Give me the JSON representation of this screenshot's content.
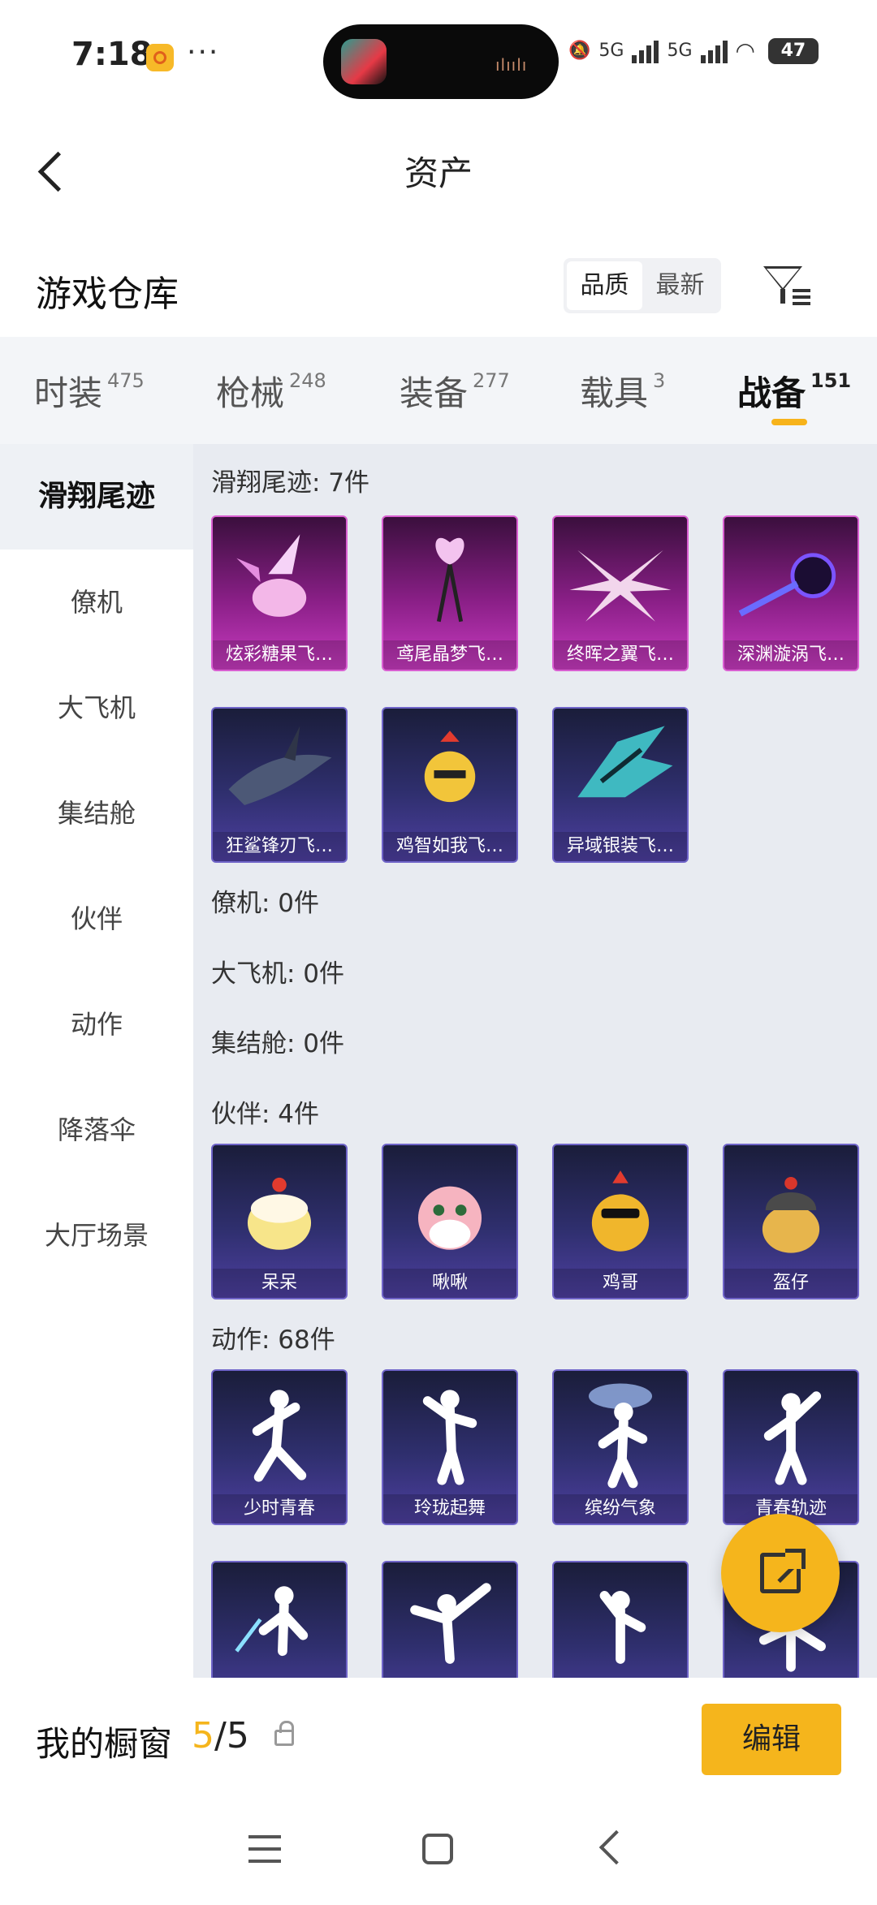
{
  "status_bar": {
    "time": "7:18",
    "network_1": "5G",
    "network_2": "5G",
    "battery": "47"
  },
  "header": {
    "title": "资产"
  },
  "warehouse": {
    "title": "游戏仓库",
    "sort_options": [
      "品质",
      "最新"
    ],
    "sort_selected": "品质"
  },
  "tabs": [
    {
      "label": "时装",
      "count": "475"
    },
    {
      "label": "枪械",
      "count": "248"
    },
    {
      "label": "装备",
      "count": "277"
    },
    {
      "label": "载具",
      "count": "3"
    },
    {
      "label": "战备",
      "count": "151",
      "active": true
    }
  ],
  "sidebar": {
    "items": [
      "滑翔尾迹",
      "僚机",
      "大飞机",
      "集结舱",
      "伙伴",
      "动作",
      "降落伞",
      "大厅场景"
    ],
    "active": "滑翔尾迹"
  },
  "sections": {
    "trail": {
      "title": "滑翔尾迹: 7件",
      "items": [
        "炫彩糖果飞…",
        "鸢尾晶梦飞…",
        "终晖之翼飞…",
        "深渊漩涡飞…",
        "狂鲨锋刃飞…",
        "鸡智如我飞…",
        "异域银装飞…"
      ]
    },
    "wingman": {
      "title": "僚机: 0件"
    },
    "plane": {
      "title": "大飞机: 0件"
    },
    "pod": {
      "title": "集结舱: 0件"
    },
    "partner": {
      "title": "伙伴: 4件",
      "items": [
        "呆呆",
        "啾啾",
        "鸡哥",
        "盔仔"
      ]
    },
    "emote": {
      "title": "动作: 68件",
      "items": [
        "少时青春",
        "玲珑起舞",
        "缤纷气象",
        "青春轨迹",
        "",
        "",
        "",
        ""
      ]
    }
  },
  "bottom": {
    "label": "我的橱窗",
    "count_current": "5",
    "count_total": "/5",
    "edit_button": "编辑"
  },
  "icons": {
    "back": "back-arrow-icon",
    "filter": "filter-icon",
    "share": "share-out-icon",
    "lock": "lock-icon"
  },
  "colors": {
    "accent": "#f5b51c",
    "purple_card": "#8a1f87",
    "blue_card": "#2f2f6e"
  }
}
